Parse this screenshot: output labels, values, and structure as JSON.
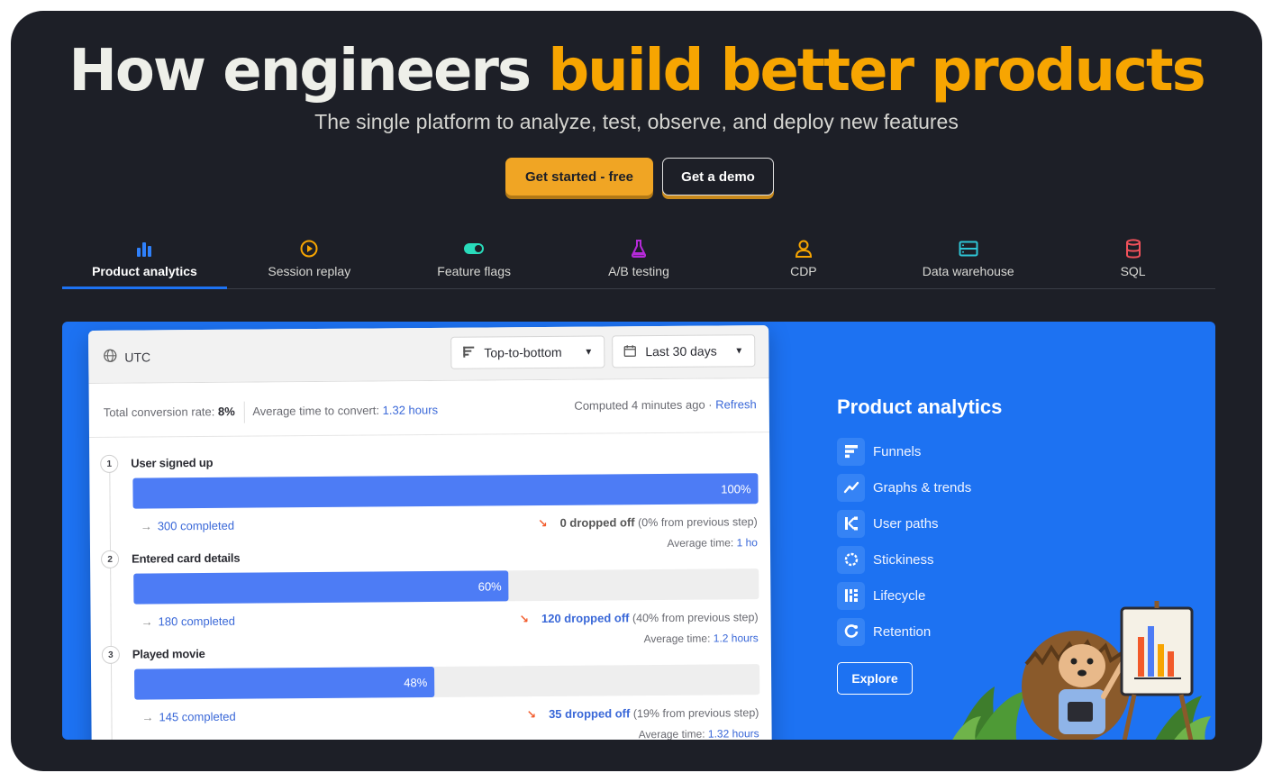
{
  "hero": {
    "title_plain": "How engineers ",
    "title_accent": "build better products",
    "subtitle": "The single platform to analyze, test, observe, and deploy new features",
    "primary_cta": "Get started - free",
    "secondary_cta": "Get a demo"
  },
  "tabs": [
    {
      "label": "Product analytics",
      "icon": "bar-chart-icon",
      "active": true
    },
    {
      "label": "Session replay",
      "icon": "replay-icon",
      "active": false
    },
    {
      "label": "Feature flags",
      "icon": "toggle-icon",
      "active": false
    },
    {
      "label": "A/B testing",
      "icon": "flask-icon",
      "active": false
    },
    {
      "label": "CDP",
      "icon": "person-icon",
      "active": false
    },
    {
      "label": "Data warehouse",
      "icon": "warehouse-icon",
      "active": false
    },
    {
      "label": "SQL",
      "icon": "database-icon",
      "active": false
    }
  ],
  "funnel": {
    "timezone": "UTC",
    "layout_select": "Top-to-bottom",
    "date_select": "Last 30 days",
    "conversion_label": "Total conversion rate:",
    "conversion_value": "8%",
    "avg_time_label": "Average time to convert:",
    "avg_time_value": "1.32 hours",
    "computed": "Computed 4 minutes ago ·",
    "refresh": "Refresh",
    "steps": [
      {
        "num": "1",
        "name": "User signed up",
        "pct": "100%",
        "fraction": 1.0,
        "completed": "300 completed",
        "dropped_value": "0 dropped off",
        "dropped_note": "(0% from previous step)",
        "avg_label": "",
        "avg_value": ""
      },
      {
        "num": "2",
        "name": "Entered card details",
        "pct": "60%",
        "fraction": 0.6,
        "completed": "180 completed",
        "dropped_value": "120 dropped off",
        "dropped_note": "(40% from previous step)",
        "avg_label": "Average time:",
        "avg_value": "1 ho"
      },
      {
        "num": "3",
        "name": "Played movie",
        "pct": "48%",
        "fraction": 0.48,
        "completed": "145 completed",
        "dropped_value": "35 dropped off",
        "dropped_note": "(19% from previous step)",
        "avg_label": "Average time:",
        "avg_value": "1.2 hours"
      }
    ],
    "next_avg_label": "Average time:",
    "next_avg_value": "1.32 hours"
  },
  "side": {
    "title": "Product analytics",
    "features": [
      {
        "label": "Funnels",
        "icon": "funnel-icon"
      },
      {
        "label": "Graphs & trends",
        "icon": "trend-icon"
      },
      {
        "label": "User paths",
        "icon": "paths-icon"
      },
      {
        "label": "Stickiness",
        "icon": "stickiness-icon"
      },
      {
        "label": "Lifecycle",
        "icon": "lifecycle-icon"
      },
      {
        "label": "Retention",
        "icon": "retention-icon"
      }
    ],
    "explore": "Explore"
  },
  "colors": {
    "background": "#1d1f27",
    "accent": "#f7a501",
    "panel_blue": "#1d72f2",
    "bar_blue": "#4d7cf5"
  }
}
